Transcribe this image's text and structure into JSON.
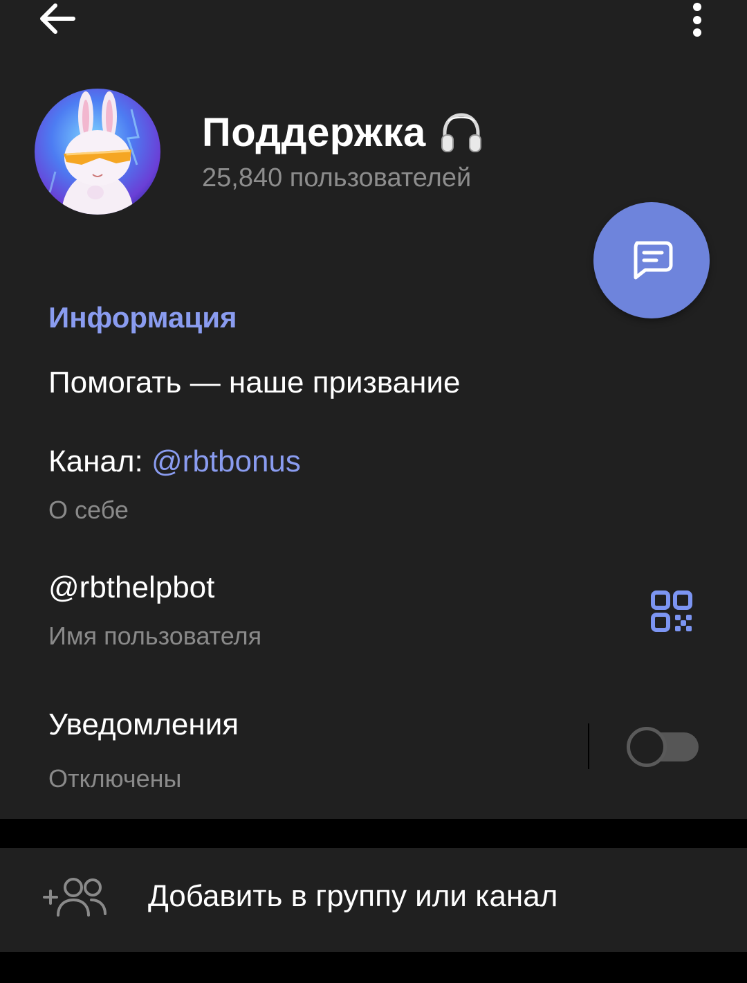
{
  "header": {
    "back_icon": "arrow-left-icon",
    "menu_icon": "more-vertical-icon",
    "title": "Поддержка",
    "title_emoji_icon": "headphones-icon",
    "subtitle": "25,840 пользователей",
    "avatar_icon": "bunny-avatar"
  },
  "fab": {
    "icon": "message-icon",
    "color": "#6e84dc"
  },
  "info": {
    "section_title": "Информация",
    "description": "Помогать — наше призвание",
    "channel_prefix": "Канал: ",
    "channel_link": "@rbtbonus",
    "channel_caption": "О себе",
    "username": "@rbthelpbot",
    "username_caption": "Имя пользователя",
    "qr_icon": "qr-code-icon",
    "notifications_label": "Уведомления",
    "notifications_status": "Отключены",
    "notifications_enabled": false
  },
  "actions": {
    "add_to_group_label": "Добавить в группу или канал",
    "add_to_group_icon": "add-user-icon"
  },
  "colors": {
    "background": "#202020",
    "accent": "#8a9cf0",
    "secondary_text": "#8a8a8a"
  }
}
